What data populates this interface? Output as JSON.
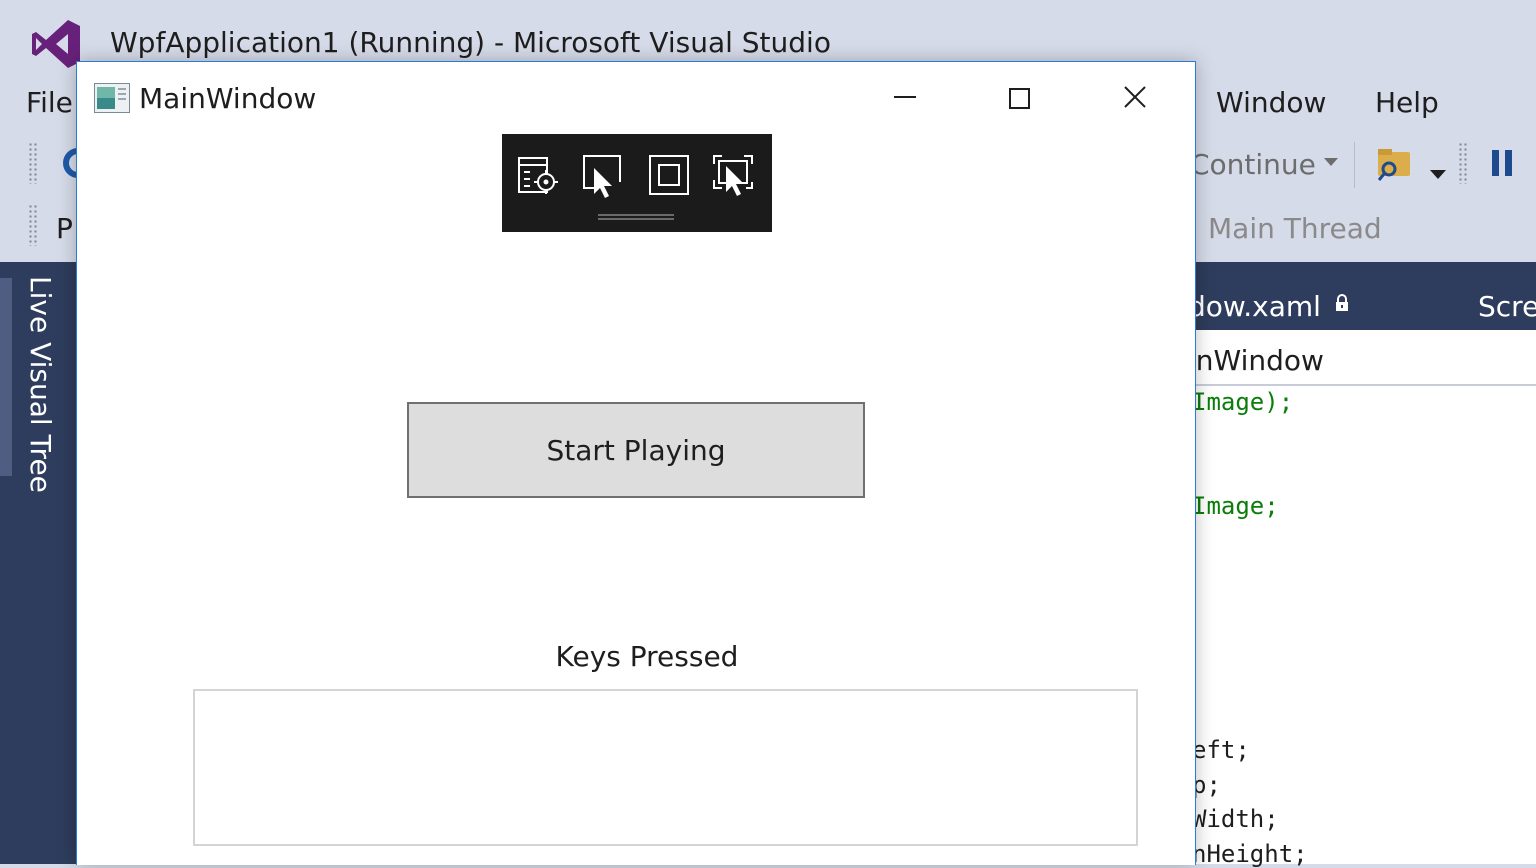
{
  "vs": {
    "title": "WpfApplication1 (Running) - Microsoft Visual Studio",
    "menu": {
      "file": "File",
      "window": "Window",
      "help": "Help"
    },
    "toolbar": {
      "continue": "Continue",
      "truncated_label": "P",
      "thread": "Main Thread"
    },
    "side_panel": {
      "live_visual_tree": "Live Visual Tree"
    },
    "editor": {
      "document_tab": "dow.xaml",
      "screen_tab": "Scre",
      "nav_dropdown": "inWindow",
      "code_lines": [
        {
          "text": "Image);",
          "color": "green"
        },
        {
          "text": "Image;",
          "color": "green"
        },
        {
          "text": "eft;",
          "color": "black"
        },
        {
          "text": "p;",
          "color": "black"
        },
        {
          "text": "Width;",
          "color": "black"
        },
        {
          "text": "nHeight;",
          "color": "black"
        }
      ]
    },
    "colors": {
      "background": "#d6dbe9",
      "dark_panel": "#2e3d5d",
      "accent": "#68217a"
    }
  },
  "app_window": {
    "title": "MainWindow",
    "controls": {
      "minimize": "minimize-icon",
      "maximize": "maximize-icon",
      "close": "close-icon"
    },
    "debug_toolbar": [
      {
        "icon": "go-to-live-visual-tree-icon"
      },
      {
        "icon": "enable-selection-icon"
      },
      {
        "icon": "display-layout-adorners-icon"
      },
      {
        "icon": "track-focused-element-icon"
      }
    ],
    "start_button": "Start Playing",
    "keys_label": "Keys Pressed",
    "keys_textbox_value": ""
  }
}
